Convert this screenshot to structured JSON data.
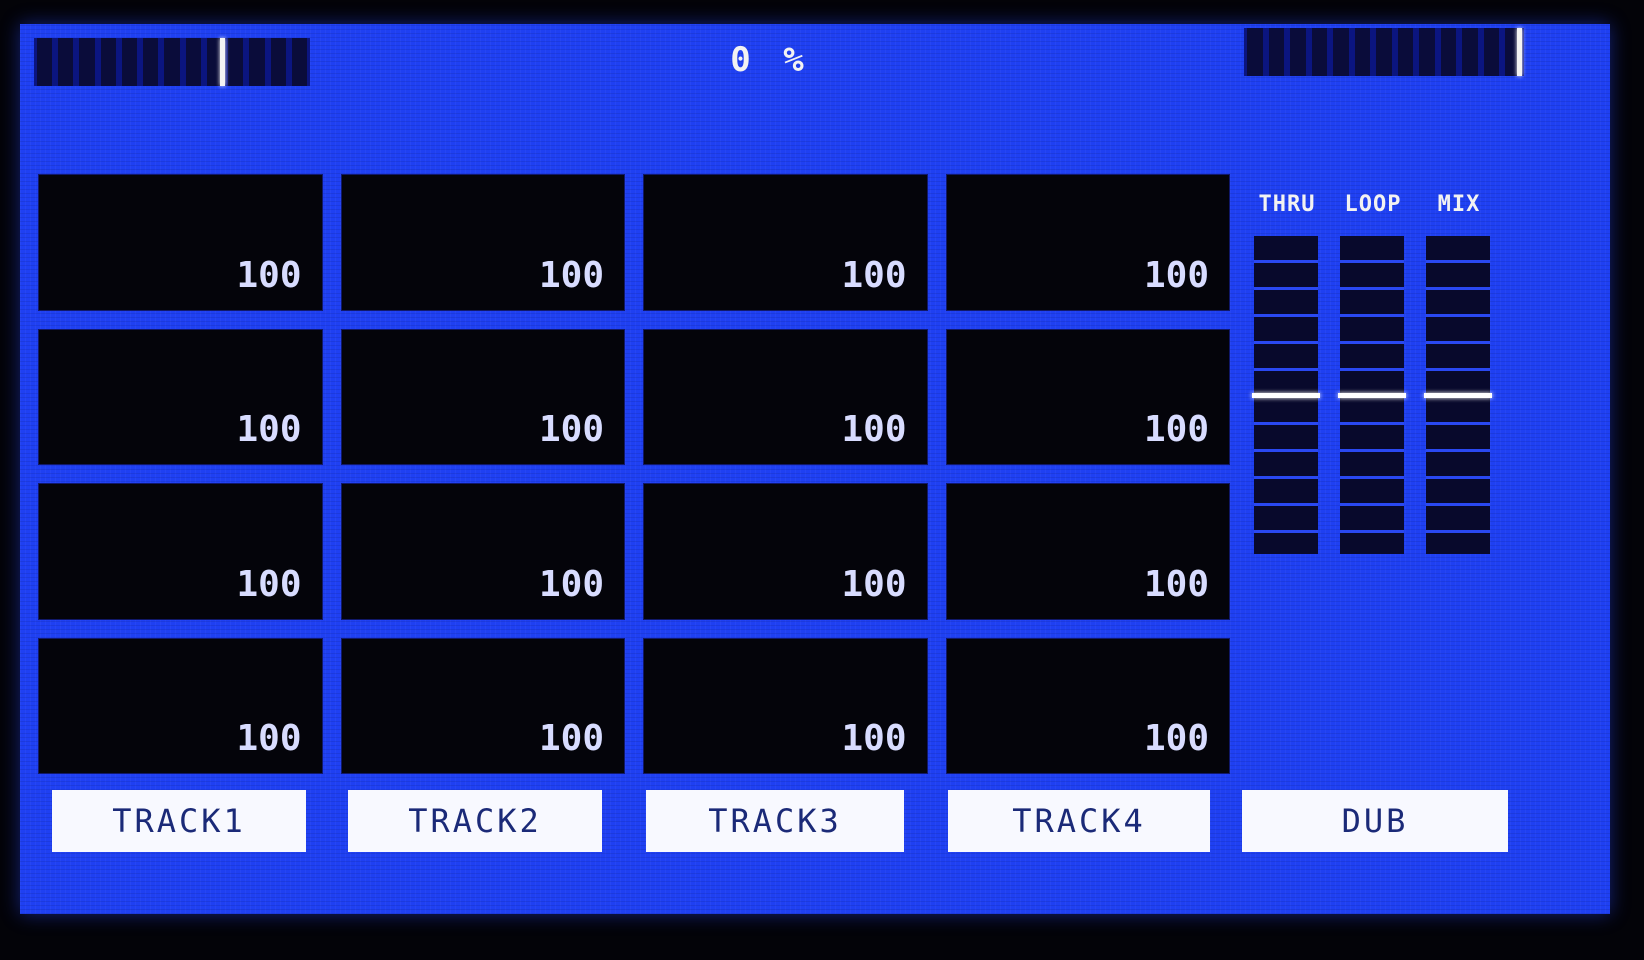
{
  "progress": {
    "label": "0 %"
  },
  "meters": {
    "left": {
      "segments": 13,
      "cursor_segment": 9
    },
    "right": {
      "segments": 13,
      "cursor_segment": 13
    }
  },
  "pads": [
    {
      "value": "100"
    },
    {
      "value": "100"
    },
    {
      "value": "100"
    },
    {
      "value": "100"
    },
    {
      "value": "100"
    },
    {
      "value": "100"
    },
    {
      "value": "100"
    },
    {
      "value": "100"
    },
    {
      "value": "100"
    },
    {
      "value": "100"
    },
    {
      "value": "100"
    },
    {
      "value": "100"
    },
    {
      "value": "100"
    },
    {
      "value": "100"
    },
    {
      "value": "100"
    },
    {
      "value": "100"
    }
  ],
  "faders": [
    {
      "label": "THRU",
      "level": 0.5
    },
    {
      "label": "LOOP",
      "level": 0.5
    },
    {
      "label": "MIX",
      "level": 0.5
    }
  ],
  "buttons": {
    "track1": "TRACK1",
    "track2": "TRACK2",
    "track3": "TRACK3",
    "track4": "TRACK4",
    "dub": "DUB"
  },
  "colors": {
    "screen_background": "#1f40f2",
    "pad_background": "#04040a",
    "button_background": "#f8f9ff",
    "button_text": "#1b2a78",
    "highlight": "#ffffff"
  }
}
